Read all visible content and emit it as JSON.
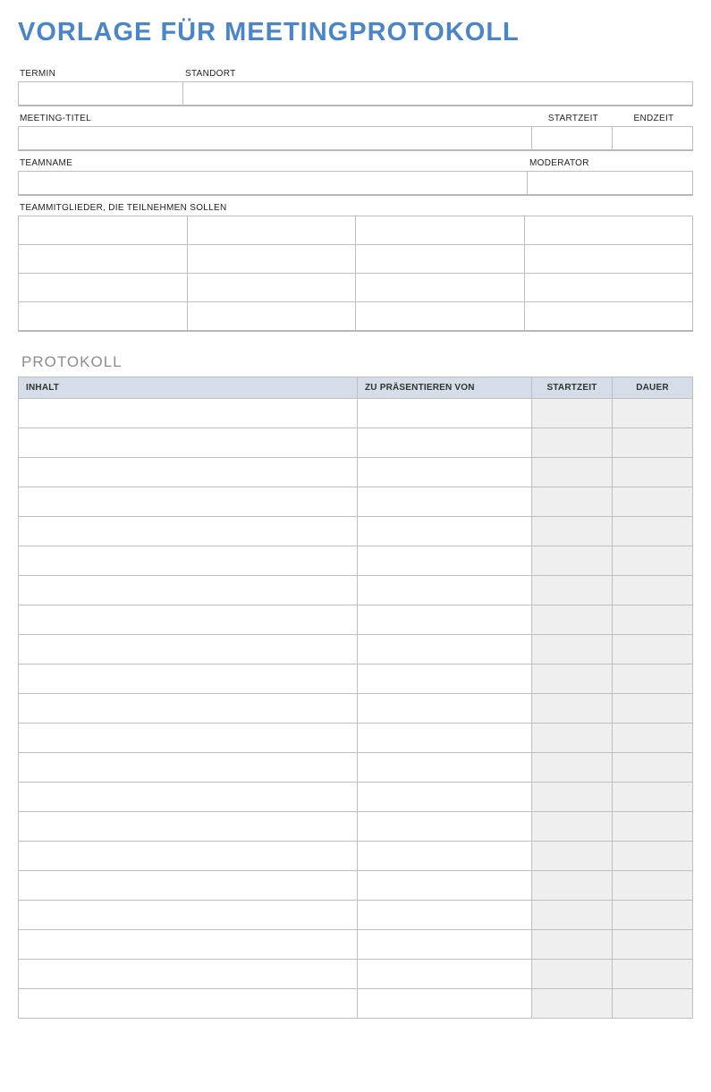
{
  "title": "VORLAGE FÜR MEETINGPROTOKOLL",
  "labels": {
    "termin": "TERMIN",
    "standort": "STANDORT",
    "meeting_titel": "MEETING-TITEL",
    "startzeit": "STARTZEIT",
    "endzeit": "ENDZEIT",
    "teamname": "TEAMNAME",
    "moderator": "MODERATOR",
    "teammitglieder": "TEAMMITGLIEDER, DIE TEILNEHMEN SOLLEN"
  },
  "fields": {
    "termin": "",
    "standort": "",
    "meeting_titel": "",
    "startzeit": "",
    "endzeit": "",
    "teamname": "",
    "moderator": ""
  },
  "team_members_grid": {
    "rows": 4,
    "cols": 4,
    "cells": [
      "",
      "",
      "",
      "",
      "",
      "",
      "",
      "",
      "",
      "",
      "",
      "",
      "",
      "",
      "",
      ""
    ]
  },
  "protokoll": {
    "section_title": "PROTOKOLL",
    "headers": {
      "inhalt": "INHALT",
      "zu_praesentieren": "ZU PRÄSENTIEREN VON",
      "startzeit": "STARTZEIT",
      "dauer": "DAUER"
    },
    "rows": [
      {
        "inhalt": "",
        "von": "",
        "start": "",
        "dauer": ""
      },
      {
        "inhalt": "",
        "von": "",
        "start": "",
        "dauer": ""
      },
      {
        "inhalt": "",
        "von": "",
        "start": "",
        "dauer": ""
      },
      {
        "inhalt": "",
        "von": "",
        "start": "",
        "dauer": ""
      },
      {
        "inhalt": "",
        "von": "",
        "start": "",
        "dauer": ""
      },
      {
        "inhalt": "",
        "von": "",
        "start": "",
        "dauer": ""
      },
      {
        "inhalt": "",
        "von": "",
        "start": "",
        "dauer": ""
      },
      {
        "inhalt": "",
        "von": "",
        "start": "",
        "dauer": ""
      },
      {
        "inhalt": "",
        "von": "",
        "start": "",
        "dauer": ""
      },
      {
        "inhalt": "",
        "von": "",
        "start": "",
        "dauer": ""
      },
      {
        "inhalt": "",
        "von": "",
        "start": "",
        "dauer": ""
      },
      {
        "inhalt": "",
        "von": "",
        "start": "",
        "dauer": ""
      },
      {
        "inhalt": "",
        "von": "",
        "start": "",
        "dauer": ""
      },
      {
        "inhalt": "",
        "von": "",
        "start": "",
        "dauer": ""
      },
      {
        "inhalt": "",
        "von": "",
        "start": "",
        "dauer": ""
      },
      {
        "inhalt": "",
        "von": "",
        "start": "",
        "dauer": ""
      },
      {
        "inhalt": "",
        "von": "",
        "start": "",
        "dauer": ""
      },
      {
        "inhalt": "",
        "von": "",
        "start": "",
        "dauer": ""
      },
      {
        "inhalt": "",
        "von": "",
        "start": "",
        "dauer": ""
      },
      {
        "inhalt": "",
        "von": "",
        "start": "",
        "dauer": ""
      },
      {
        "inhalt": "",
        "von": "",
        "start": "",
        "dauer": ""
      }
    ]
  }
}
